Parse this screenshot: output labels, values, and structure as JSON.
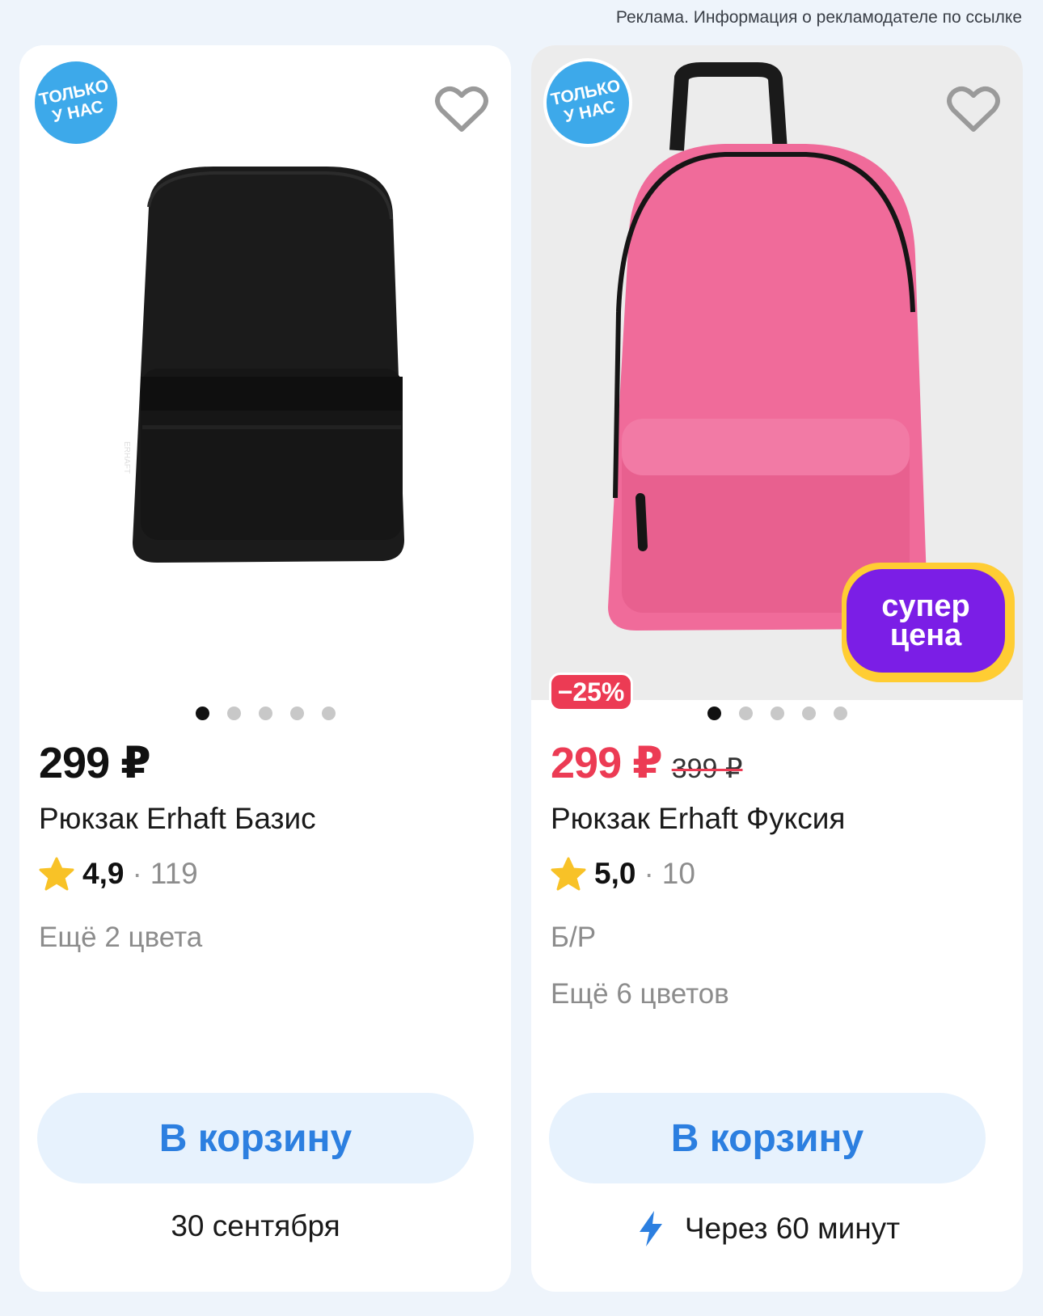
{
  "ad_notice": "Реклама. Информация о рекламодателе по ссылке",
  "products": [
    {
      "badge_line1": "ТОЛЬКО",
      "badge_line2": "У НАС",
      "price": "299 ₽",
      "title": "Рюкзак Erhaft Базис",
      "rating": "4,9",
      "rating_sep": "·",
      "reviews": "119",
      "colors_note": "Ещё 2 цвета",
      "cart_label": "В корзину",
      "delivery": "30 сентября",
      "image_dots": 5,
      "active_dot": 0,
      "product_color": "#1a1a1a"
    },
    {
      "badge_line1": "ТОЛЬКО",
      "badge_line2": "У НАС",
      "discount": "−25%",
      "super_line1": "супер",
      "super_line2": "цена",
      "price": "299 ₽",
      "old_price": "399 ₽",
      "title": "Рюкзак Erhaft Фуксия",
      "rating": "5,0",
      "rating_sep": "·",
      "reviews": "10",
      "condition": "Б/Р",
      "colors_note": "Ещё 6 цветов",
      "cart_label": "В корзину",
      "delivery": "Через 60 минут",
      "delivery_icon": "lightning-icon",
      "image_dots": 5,
      "active_dot": 0,
      "product_color": "#f06b9a"
    }
  ],
  "colors": {
    "accent_blue": "#2c7fe0",
    "sale_red": "#ec3b54",
    "star_yellow": "#f8c227",
    "badge_blue": "#3da9ea"
  }
}
